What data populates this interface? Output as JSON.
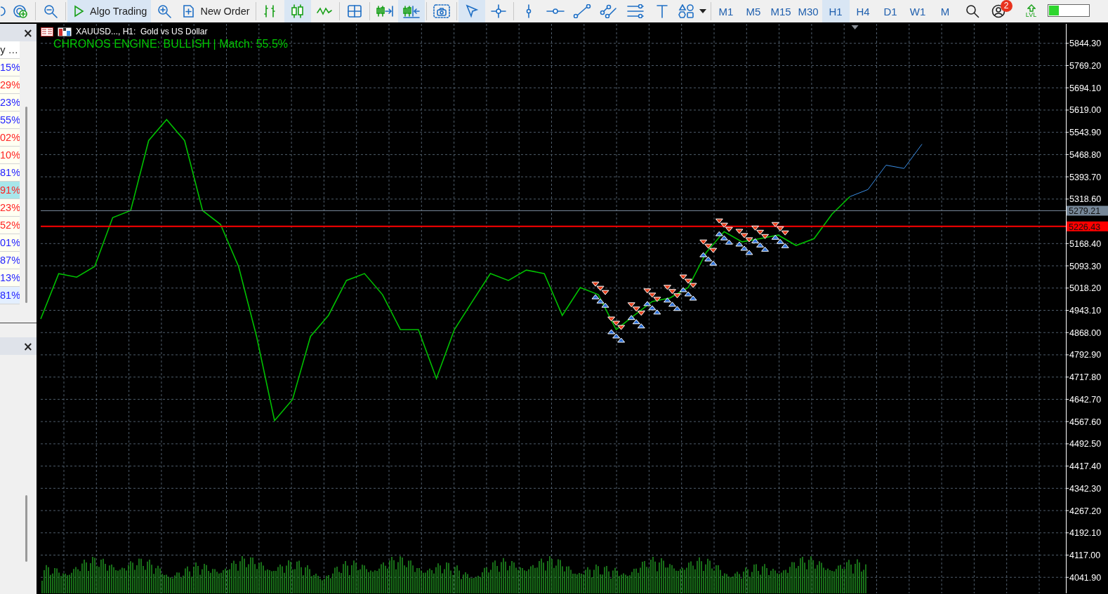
{
  "toolbar": {
    "items": [
      {
        "kind": "icon",
        "pressed": false
      },
      {
        "kind": "icon",
        "pressed": false
      },
      {
        "kind": "separator"
      },
      {
        "kind": "icon",
        "pressed": false
      },
      {
        "kind": "separator"
      },
      {
        "kind": "button",
        "label": "Algo Trading",
        "pressed": true
      },
      {
        "kind": "icon",
        "pressed": false
      },
      {
        "kind": "button",
        "label": "New Order",
        "pressed": false
      },
      {
        "kind": "separator"
      },
      {
        "kind": "icon",
        "pressed": false
      },
      {
        "kind": "icon",
        "pressed": true
      },
      {
        "kind": "icon",
        "pressed": false
      },
      {
        "kind": "separator"
      },
      {
        "kind": "icon",
        "pressed": false
      },
      {
        "kind": "separator"
      },
      {
        "kind": "icon",
        "pressed": false
      },
      {
        "kind": "icon",
        "pressed": true
      },
      {
        "kind": "separator"
      },
      {
        "kind": "icon",
        "pressed": false
      },
      {
        "kind": "separator"
      },
      {
        "kind": "icon",
        "pressed": true
      },
      {
        "kind": "icon",
        "pressed": false
      },
      {
        "kind": "separator"
      },
      {
        "kind": "icon",
        "pressed": false
      },
      {
        "kind": "icon",
        "pressed": false
      },
      {
        "kind": "icon",
        "pressed": false
      },
      {
        "kind": "icon",
        "pressed": false
      },
      {
        "kind": "icon",
        "pressed": false
      },
      {
        "kind": "icon",
        "pressed": false
      },
      {
        "kind": "icon",
        "pressed": false
      },
      {
        "kind": "separator"
      }
    ],
    "timeframes": [
      {
        "label": "M1",
        "selected": false
      },
      {
        "label": "M5",
        "selected": false
      },
      {
        "label": "M15",
        "selected": false
      },
      {
        "label": "M30",
        "selected": false
      },
      {
        "label": "H1",
        "selected": true
      },
      {
        "label": "H4",
        "selected": false
      },
      {
        "label": "D1",
        "selected": false
      },
      {
        "label": "W1",
        "selected": false
      },
      {
        "label": "M",
        "selected": false
      }
    ],
    "notification_count": "2",
    "lvl_label": "LVL"
  },
  "market_watch": {
    "close": "×",
    "column_header": "y …",
    "rows": [
      {
        "value": "15%",
        "color": "#2222ff",
        "selected": false,
        "hovered": false
      },
      {
        "value": "29%",
        "color": "#ff2222",
        "selected": false,
        "hovered": false
      },
      {
        "value": "23%",
        "color": "#2222ff",
        "selected": false,
        "hovered": false
      },
      {
        "value": "55%",
        "color": "#2222ff",
        "selected": false,
        "hovered": false
      },
      {
        "value": "02%",
        "color": "#ff2222",
        "selected": false,
        "hovered": false
      },
      {
        "value": "10%",
        "color": "#ff2222",
        "selected": false,
        "hovered": false
      },
      {
        "value": "81%",
        "color": "#2222ff",
        "selected": false,
        "hovered": false
      },
      {
        "value": "91%",
        "color": "#ff2222",
        "selected": true,
        "hovered": false
      },
      {
        "value": "23%",
        "color": "#ff2222",
        "selected": false,
        "hovered": false
      },
      {
        "value": "52%",
        "color": "#ff2222",
        "selected": false,
        "hovered": false
      },
      {
        "value": "01%",
        "color": "#2222ff",
        "selected": false,
        "hovered": false
      },
      {
        "value": "87%",
        "color": "#2222ff",
        "selected": false,
        "hovered": false
      },
      {
        "value": "13%",
        "color": "#2222ff",
        "selected": false,
        "hovered": false
      },
      {
        "value": "81%",
        "color": "#2222ff",
        "selected": false,
        "hovered": true
      }
    ]
  },
  "panel_2": {
    "close": "×"
  },
  "chart": {
    "symbol_title": "XAUUSD..., H1:  Gold vs US Dollar",
    "indicator_text": "CHRONOS ENGINE: BULLISH | Match: 55.5%",
    "chart_data": {
      "type": "line",
      "grid": true,
      "ylim": [
        3988,
        5910
      ],
      "yticks": [
        {
          "value": 5844.3,
          "label": "5844.30"
        },
        {
          "value": 5769.2,
          "label": "5769.20"
        },
        {
          "value": 5694.1,
          "label": "5694.10"
        },
        {
          "value": 5619.0,
          "label": "5619.00"
        },
        {
          "value": 5543.9,
          "label": "5543.90"
        },
        {
          "value": 5468.8,
          "label": "5468.80"
        },
        {
          "value": 5393.7,
          "label": "5393.70"
        },
        {
          "value": 5318.6,
          "label": "5318.60"
        },
        {
          "value": 5168.4,
          "label": "5168.40"
        },
        {
          "value": 5093.3,
          "label": "5093.30"
        },
        {
          "value": 5018.2,
          "label": "5018.20"
        },
        {
          "value": 4943.1,
          "label": "4943.10"
        },
        {
          "value": 4868.0,
          "label": "4868.00"
        },
        {
          "value": 4792.9,
          "label": "4792.90"
        },
        {
          "value": 4717.8,
          "label": "4717.80"
        },
        {
          "value": 4642.7,
          "label": "4642.70"
        },
        {
          "value": 4567.6,
          "label": "4567.60"
        },
        {
          "value": 4492.5,
          "label": "4492.50"
        },
        {
          "value": 4417.4,
          "label": "4417.40"
        },
        {
          "value": 4342.3,
          "label": "4342.30"
        },
        {
          "value": 4267.2,
          "label": "4267.20"
        },
        {
          "value": 4192.1,
          "label": "4192.10"
        },
        {
          "value": 4117.0,
          "label": "4117.00"
        },
        {
          "value": 4041.9,
          "label": "4041.90"
        }
      ],
      "series": [
        {
          "color": "#00c000",
          "values": [
            4914,
            5067,
            5055,
            5091,
            5256,
            5280,
            5516,
            5587,
            5516,
            5280,
            5233,
            5091,
            4855,
            4571,
            4642,
            4855,
            4926,
            5044,
            5067,
            4996,
            4878,
            4878,
            4713,
            4878,
            4973,
            5067,
            5044,
            5079,
            5067,
            4926,
            5020,
            4996,
            4878,
            4926,
            4973,
            4985,
            5020,
            5138,
            5209,
            5174,
            5185,
            5197,
            5162,
            5185,
            5268,
            5327,
            null,
            null,
            null,
            null
          ]
        },
        {
          "color": "#3a8ee6",
          "values": [
            null,
            null,
            null,
            null,
            null,
            null,
            null,
            null,
            null,
            null,
            null,
            null,
            null,
            null,
            null,
            null,
            null,
            null,
            null,
            null,
            null,
            null,
            null,
            null,
            null,
            null,
            null,
            null,
            null,
            null,
            null,
            null,
            null,
            null,
            null,
            null,
            null,
            null,
            null,
            null,
            null,
            null,
            null,
            null,
            null,
            5327,
            5351,
            5433,
            5422,
            5504
          ]
        }
      ],
      "ref_lines": [
        {
          "axis": "y",
          "value": 5279.21,
          "label": "5279.21",
          "color": "#778899"
        },
        {
          "axis": "y",
          "value": 5226.43,
          "label": "5226.43",
          "color": "#ff0000"
        }
      ]
    }
  }
}
